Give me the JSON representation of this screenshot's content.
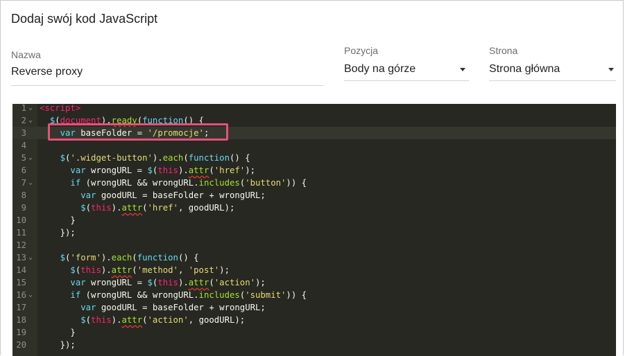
{
  "title": "Dodaj swój kod JavaScript",
  "fields": {
    "name": {
      "label": "Nazwa",
      "value": "Reverse proxy"
    },
    "position": {
      "label": "Pozycja",
      "value": "Body na górze"
    },
    "page": {
      "label": "Strona",
      "value": "Strona główna"
    }
  },
  "editor": {
    "lines": [
      {
        "n": "1",
        "fold": true,
        "text": "<script>"
      },
      {
        "n": "2",
        "fold": true,
        "text": "  $(document).ready(function() {"
      },
      {
        "n": "3",
        "fold": false,
        "text": "    var baseFolder = '/promocje';"
      },
      {
        "n": "4",
        "fold": false,
        "text": ""
      },
      {
        "n": "5",
        "fold": true,
        "text": "    $('.widget-button').each(function() {"
      },
      {
        "n": "6",
        "fold": false,
        "text": "      var wrongURL = $(this).attr('href');"
      },
      {
        "n": "7",
        "fold": true,
        "text": "      if (wrongURL && wrongURL.includes('button')) {"
      },
      {
        "n": "8",
        "fold": false,
        "text": "        var goodURL = baseFolder + wrongURL;"
      },
      {
        "n": "9",
        "fold": false,
        "text": "        $(this).attr('href', goodURL);"
      },
      {
        "n": "10",
        "fold": false,
        "text": "      }"
      },
      {
        "n": "11",
        "fold": false,
        "text": "    });"
      },
      {
        "n": "12",
        "fold": false,
        "text": ""
      },
      {
        "n": "13",
        "fold": true,
        "text": "    $('form').each(function() {"
      },
      {
        "n": "14",
        "fold": false,
        "text": "      $(this).attr('method', 'post');"
      },
      {
        "n": "15",
        "fold": false,
        "text": "      var wrongURL = $(this).attr('action');"
      },
      {
        "n": "16",
        "fold": true,
        "text": "      if (wrongURL && wrongURL.includes('submit')) {"
      },
      {
        "n": "17",
        "fold": false,
        "text": "        var goodURL = baseFolder + wrongURL;"
      },
      {
        "n": "18",
        "fold": false,
        "text": "        $(this).attr('action', goodURL);"
      },
      {
        "n": "19",
        "fold": false,
        "text": "      }"
      },
      {
        "n": "20",
        "fold": false,
        "text": "    });"
      }
    ],
    "active_line": "3",
    "colors": {
      "background": "#272822",
      "highlight": "#e8507a"
    }
  }
}
